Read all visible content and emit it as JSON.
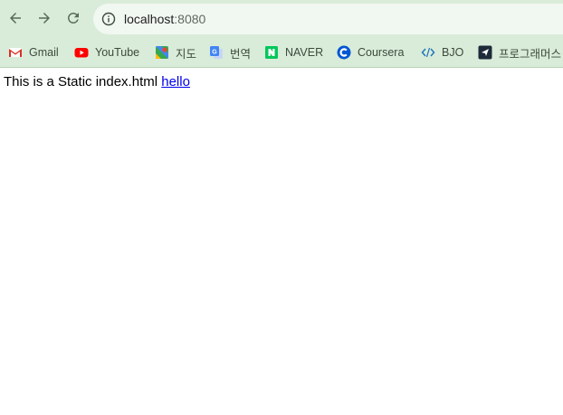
{
  "browser": {
    "url_host": "localhost",
    "url_port": ":8080",
    "nav": {
      "back_icon": "back-arrow-icon",
      "forward_icon": "forward-arrow-icon",
      "reload_icon": "reload-icon",
      "info_icon": "info-icon"
    },
    "colors": {
      "chrome_bg": "#d9ecd9",
      "omnibox_bg": "#f1f7f1",
      "link": "#0000ee"
    }
  },
  "bookmarks": [
    {
      "label": "Gmail",
      "icon": "gmail-icon"
    },
    {
      "label": "YouTube",
      "icon": "youtube-icon"
    },
    {
      "label": "지도",
      "icon": "maps-icon"
    },
    {
      "label": "번역",
      "icon": "translate-icon"
    },
    {
      "label": "NAVER",
      "icon": "naver-icon"
    },
    {
      "label": "Coursera",
      "icon": "coursera-icon"
    },
    {
      "label": "BJO",
      "icon": "code-icon"
    },
    {
      "label": "프로그래머스",
      "icon": "programmers-icon"
    }
  ],
  "page": {
    "text": "This is a Static index.html",
    "link_label": "hello"
  }
}
